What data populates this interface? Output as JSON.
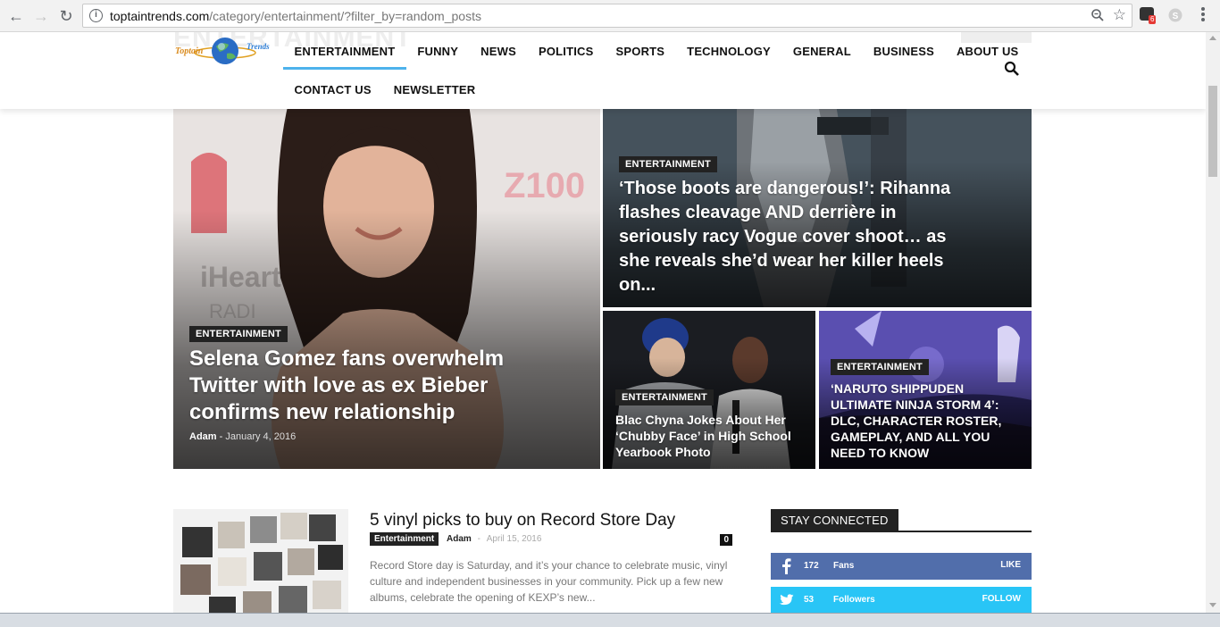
{
  "browser": {
    "url_host": "toptaintrends.com",
    "url_path": "/category/entertainment/?filter_by=random_posts",
    "extension_badge": "6"
  },
  "header": {
    "ghost_title": "ENTERTAINMENT",
    "logo_text_left": "Toptain",
    "logo_text_right": "Trends",
    "nav": [
      {
        "label": "ENTERTAINMENT"
      },
      {
        "label": "FUNNY"
      },
      {
        "label": "NEWS"
      },
      {
        "label": "POLITICS"
      },
      {
        "label": "SPORTS"
      },
      {
        "label": "TECHNOLOGY"
      },
      {
        "label": "GENERAL"
      },
      {
        "label": "BUSINESS"
      },
      {
        "label": "ABOUT US"
      },
      {
        "label": "CONTACT US"
      },
      {
        "label": "NEWSLETTER"
      }
    ]
  },
  "hero": [
    {
      "category": "ENTERTAINMENT",
      "title": "Selena Gomez fans overwhelm Twitter with love as ex Bieber confirms new relationship",
      "author": "Adam",
      "date": "January 4, 2016"
    },
    {
      "category": "ENTERTAINMENT",
      "title": "‘Those boots are dangerous!’: Rihanna flashes cleavage AND derrière in seriously racy Vogue cover shoot… as she reveals she’d wear her killer heels on..."
    },
    {
      "category": "ENTERTAINMENT",
      "title": "Blac Chyna Jokes About Her ‘Chubby Face’ in High School Yearbook Photo"
    },
    {
      "category": "ENTERTAINMENT",
      "title": "‘NARUTO SHIPPUDEN ULTIMATE NINJA STORM 4’: DLC, CHARACTER ROSTER, GAMEPLAY, AND ALL YOU NEED TO KNOW"
    }
  ],
  "articles": [
    {
      "title": "5 vinyl picks to buy on Record Store Day",
      "tag": "Entertainment",
      "author": "Adam",
      "date": "April 15, 2016",
      "comments": "0",
      "excerpt": "Record Store day is Saturday, and it’s your chance to celebrate music, vinyl culture and independent businesses in your community. Pick up a few new albums, celebrate the opening of KEXP’s new..."
    }
  ],
  "sidebar": {
    "title": "STAY CONNECTED",
    "facebook": {
      "count": "172",
      "label": "Fans",
      "action": "LIKE",
      "color": "#516eab"
    },
    "twitter": {
      "count": "53",
      "label": "Followers",
      "action": "FOLLOW",
      "color": "#29c5f6"
    }
  },
  "colors": {
    "accent": "#4db2ec",
    "tag_bg": "#222222"
  }
}
